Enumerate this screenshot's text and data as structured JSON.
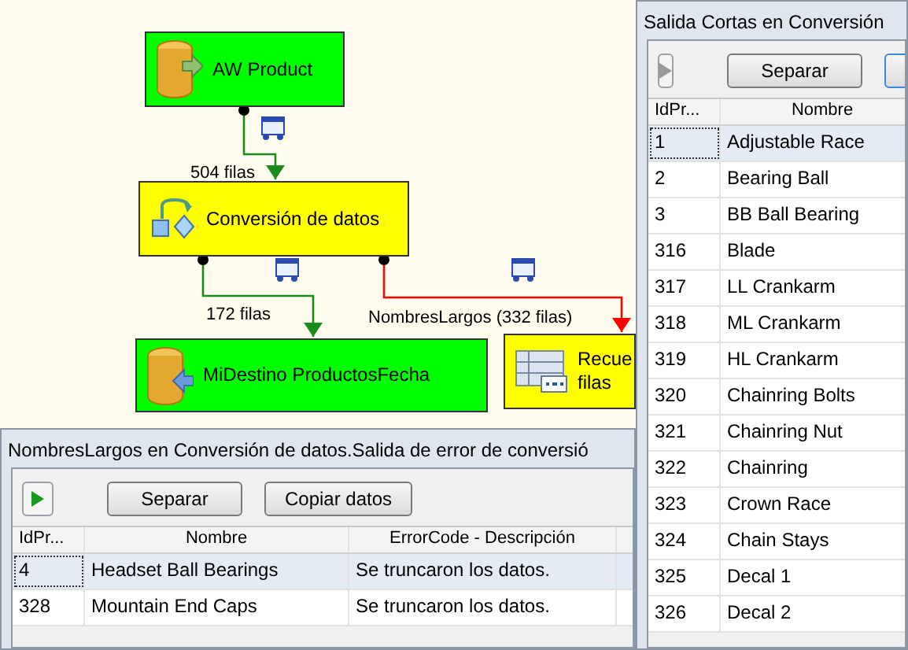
{
  "canvas": {
    "nodes": [
      {
        "kind": "source",
        "color": "#00ff00",
        "lines": [
          "AW Product"
        ]
      },
      {
        "kind": "transform",
        "color": "#ffff00",
        "lines": [
          "Conversión de datos"
        ]
      },
      {
        "kind": "destination",
        "color": "#00ff00",
        "lines": [
          "MiDestino ProductosFecha"
        ]
      },
      {
        "kind": "rowcount",
        "color": "#ffff00",
        "lines": [
          "Recue",
          "filas"
        ]
      }
    ],
    "paths": [
      {
        "kind": "success",
        "label": "504 filas"
      },
      {
        "kind": "success",
        "label": "172 filas"
      },
      {
        "kind": "error",
        "label": "NombresLargos (332 filas)"
      }
    ]
  },
  "error_viewer": {
    "title": "NombresLargos en Conversión de datos.Salida de error de conversió",
    "play_enabled": true,
    "buttons": [
      "Separar",
      "Copiar datos"
    ],
    "columns": [
      "IdPr...",
      "Nombre",
      "ErrorCode - Descripción"
    ],
    "rows": [
      {
        "cells": [
          "4",
          "Headset Ball Bearings",
          "Se truncaron los datos."
        ],
        "selected": true
      },
      {
        "cells": [
          "328",
          "Mountain End Caps",
          "Se truncaron los datos."
        ],
        "selected": false
      }
    ]
  },
  "short_viewer": {
    "title": "Salida Cortas en Conversión",
    "play_enabled": false,
    "buttons": [
      "Separar"
    ],
    "columns": [
      "IdPr...",
      "Nombre"
    ],
    "rows": [
      {
        "cells": [
          "1",
          "Adjustable Race"
        ],
        "selected": true
      },
      {
        "cells": [
          "2",
          "Bearing Ball"
        ],
        "selected": false
      },
      {
        "cells": [
          "3",
          "BB Ball Bearing"
        ],
        "selected": false
      },
      {
        "cells": [
          "316",
          "Blade"
        ],
        "selected": false
      },
      {
        "cells": [
          "317",
          "LL Crankarm"
        ],
        "selected": false
      },
      {
        "cells": [
          "318",
          "ML Crankarm"
        ],
        "selected": false
      },
      {
        "cells": [
          "319",
          "HL Crankarm"
        ],
        "selected": false
      },
      {
        "cells": [
          "320",
          "Chainring Bolts"
        ],
        "selected": false
      },
      {
        "cells": [
          "321",
          "Chainring Nut"
        ],
        "selected": false
      },
      {
        "cells": [
          "322",
          "Chainring"
        ],
        "selected": false
      },
      {
        "cells": [
          "323",
          "Crown Race"
        ],
        "selected": false
      },
      {
        "cells": [
          "324",
          "Chain Stays"
        ],
        "selected": false
      },
      {
        "cells": [
          "325",
          "Decal 1"
        ],
        "selected": false
      },
      {
        "cells": [
          "326",
          "Decal 2"
        ],
        "selected": false
      }
    ]
  }
}
